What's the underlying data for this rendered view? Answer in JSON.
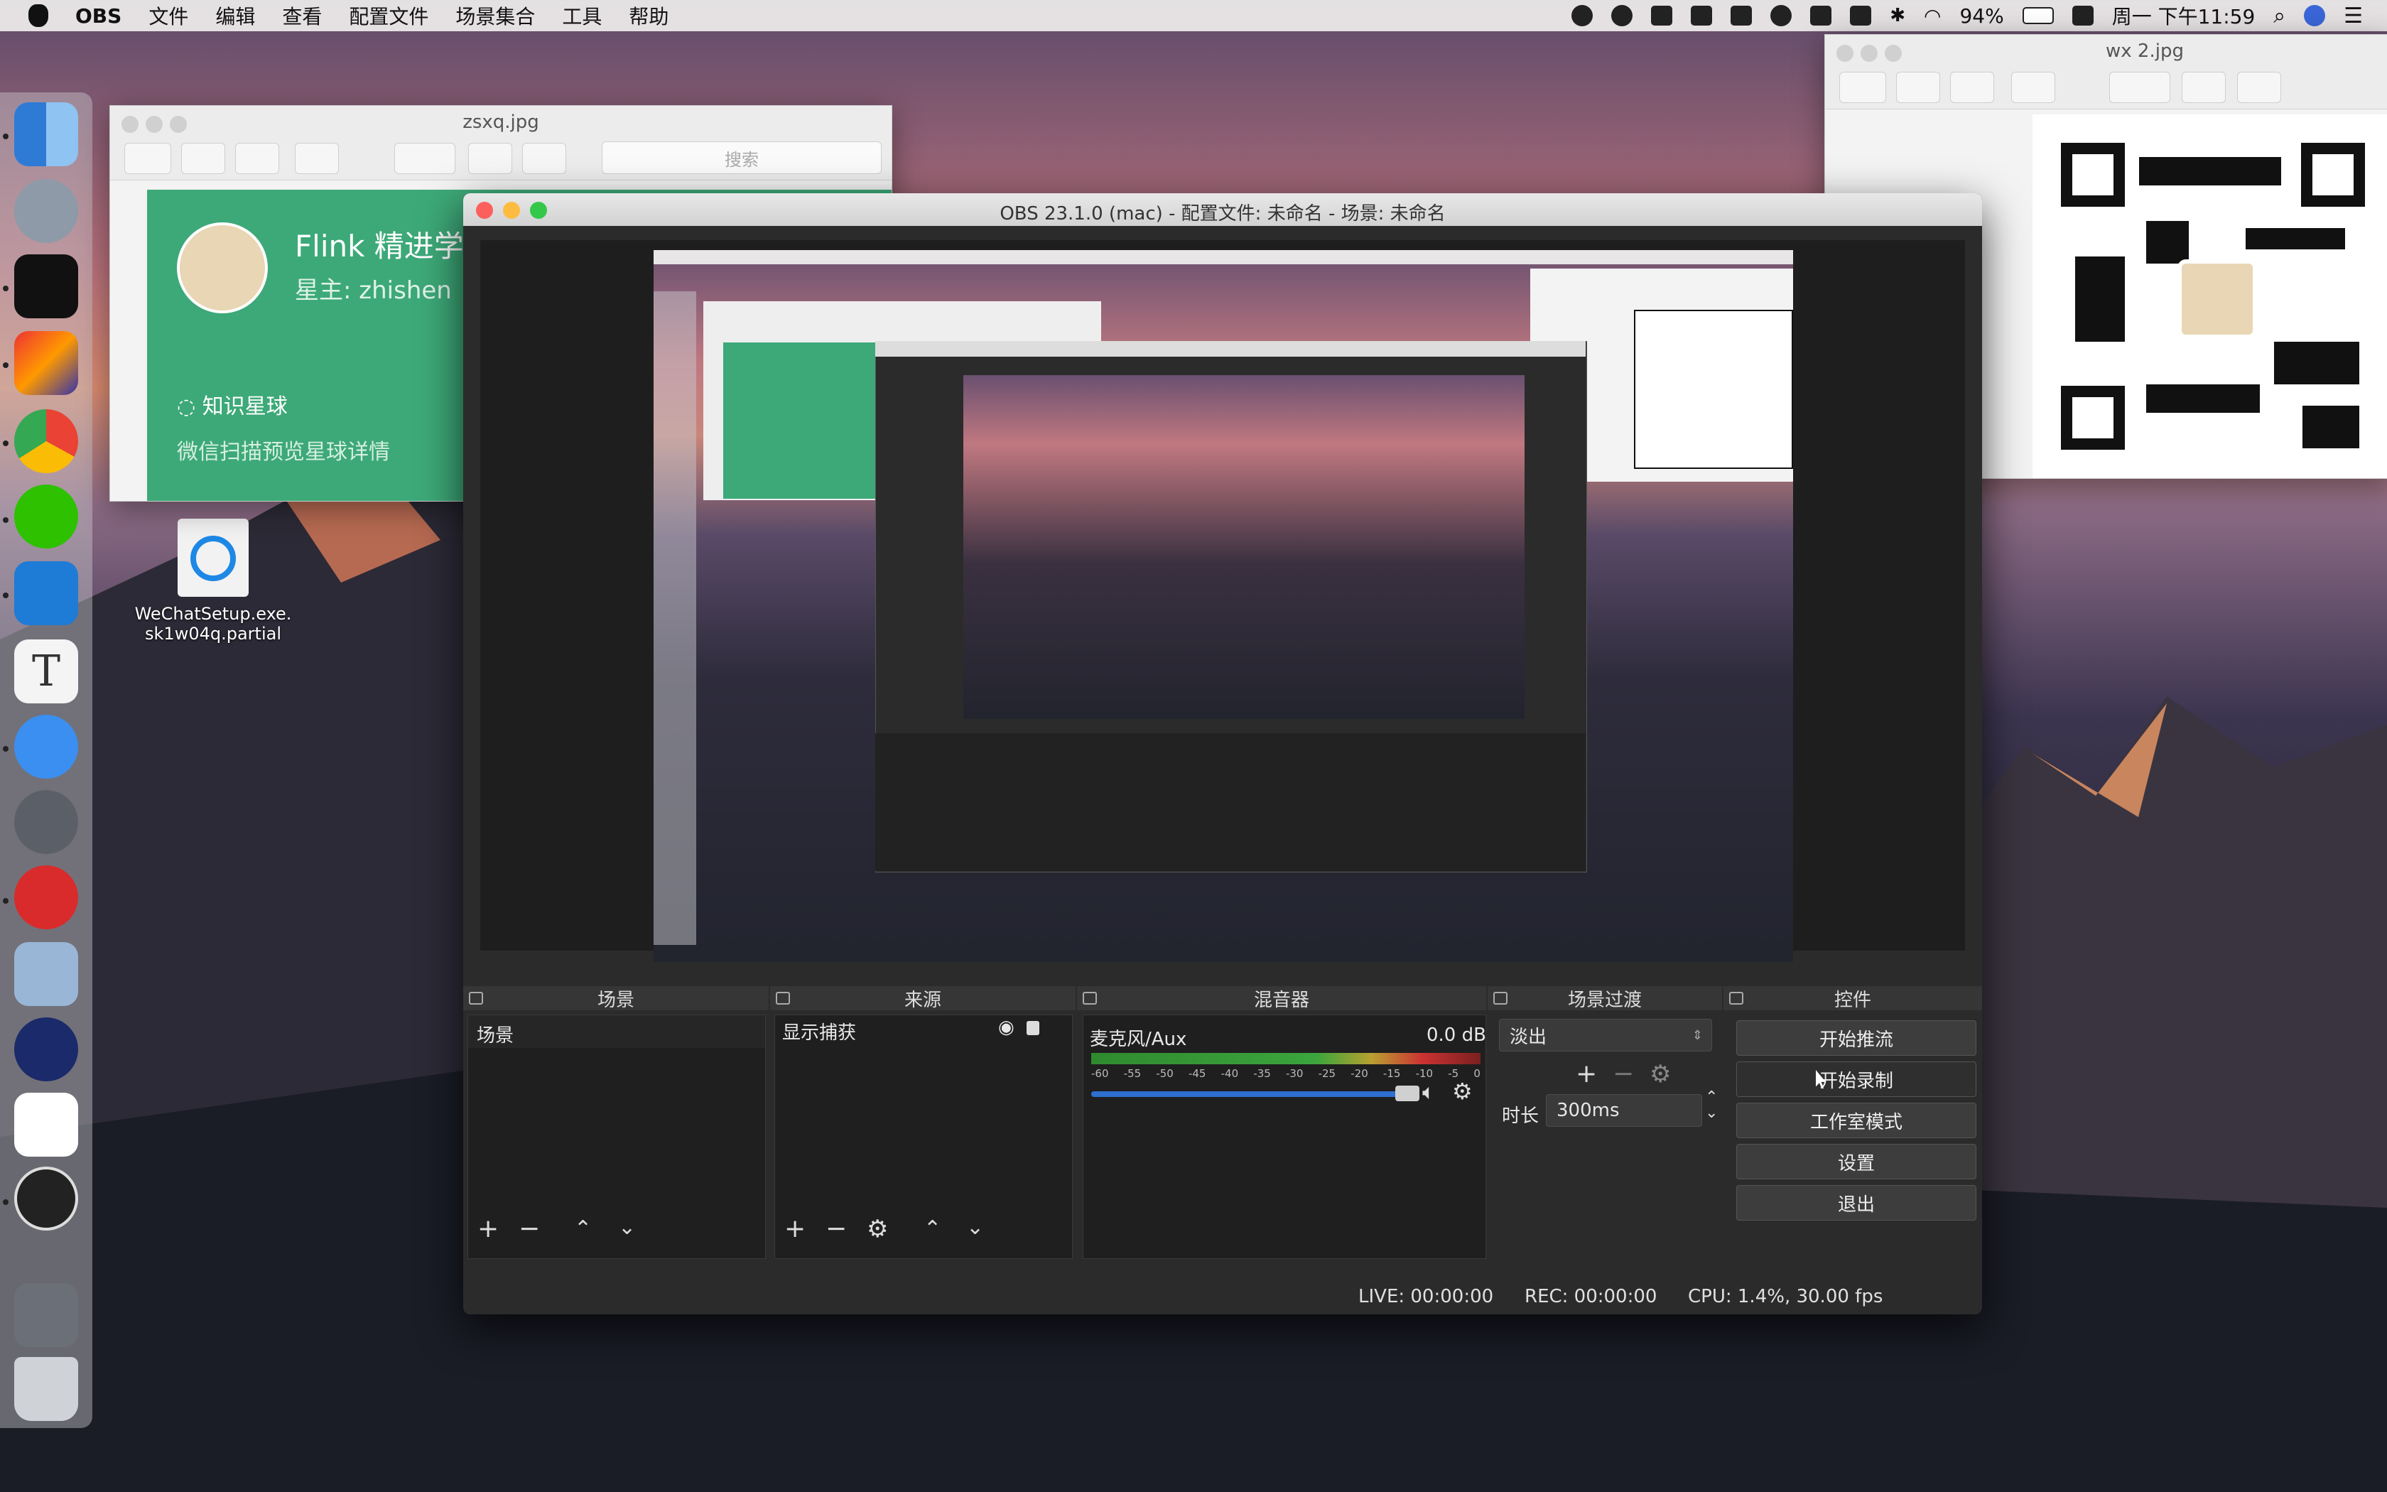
{
  "menubar": {
    "app": "OBS",
    "menus": [
      "文件",
      "编辑",
      "查看",
      "配置文件",
      "场景集合",
      "工具",
      "帮助"
    ],
    "battery": "94%",
    "clock": "周一 下午11:59"
  },
  "desktop": {
    "file_line1": "WeChatSetup.exe.",
    "file_line2": "sk1w04q.partial"
  },
  "preview_left": {
    "title": "zsxq.jpg",
    "search_placeholder": "搜索",
    "card_title": "Flink 精进学",
    "card_owner": "星主: zhishen",
    "card_link": "知识星球",
    "card_hint": "微信扫描预览星球详情"
  },
  "preview_right": {
    "title": "wx 2.jpg"
  },
  "obs": {
    "title": "OBS 23.1.0 (mac) - 配置文件: 未命名 - 场景: 未命名",
    "panels": {
      "scenes": "场景",
      "sources": "来源",
      "mixer": "混音器",
      "transitions": "场景过渡",
      "controls": "控件"
    },
    "scene_item": "场景",
    "source_item": "显示捕获",
    "mixer": {
      "track": "麦克风/Aux",
      "level": "0.0 dB",
      "ticks": [
        "-60",
        "-55",
        "-50",
        "-45",
        "-40",
        "-35",
        "-30",
        "-25",
        "-20",
        "-15",
        "-10",
        "-5",
        "0"
      ]
    },
    "transition": {
      "type": "淡出",
      "duration_label": "时长",
      "duration_value": "300ms"
    },
    "controls": {
      "start_stream": "开始推流",
      "start_record": "开始录制",
      "studio_mode": "工作室模式",
      "settings": "设置",
      "exit": "退出"
    },
    "status": {
      "live": "LIVE: 00:00:00",
      "rec": "REC: 00:00:00",
      "cpu": "CPU: 1.4%, 30.00 fps"
    }
  },
  "colors": {
    "obs_bg": "#2b2b2b",
    "panel": "#1f1f1f",
    "accent_green": "#3da978",
    "slider_blue": "#2e6fd0"
  }
}
